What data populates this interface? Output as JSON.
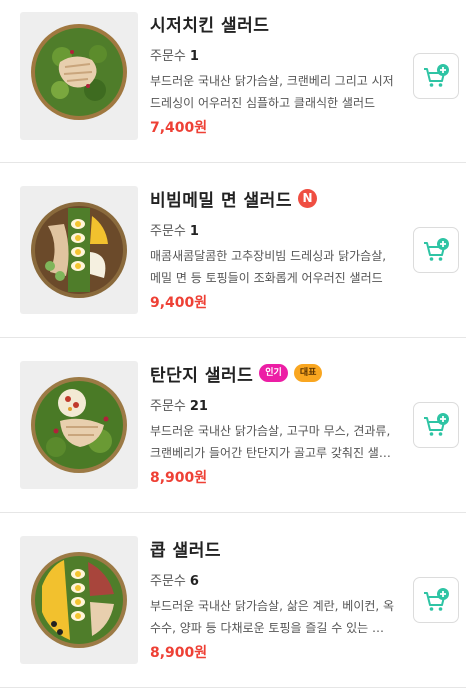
{
  "items": [
    {
      "name": "시저치킨 샐러드",
      "orders_label": "주문수",
      "orders": "1",
      "description": "부드러운 국내산 닭가슴살, 크랜베리 그리고 시저 드레싱이 어우러진 심플하고 클래식한 샐러드",
      "price": "7,400원"
    },
    {
      "name": "비빔메밀 면 샐러드",
      "new_badge": "N",
      "orders_label": "주문수",
      "orders": "1",
      "description": "매콤새콤달콤한 고추장비빔 드레싱과 닭가슴살, 메밀 면 등 토핑들이 조화롭게 어우러진 샐러드",
      "price": "9,400원"
    },
    {
      "name": "탄단지 샐러드",
      "tags": [
        "인기",
        "대표"
      ],
      "orders_label": "주문수",
      "orders": "21",
      "description": "부드러운 국내산 닭가슴살, 고구마 무스, 견과류, 크랜베리가 들어간 탄단지가 골고루 갖춰진 샐러드",
      "price": "8,900원"
    },
    {
      "name": "콥 샐러드",
      "orders_label": "주문수",
      "orders": "6",
      "description": "부드러운 국내산 닭가슴살, 삶은 계란, 베이컨, 옥수수, 양파 등 다채로운 토핑을 즐길 수 있는 샐러드",
      "price": "8,900원"
    }
  ],
  "colors": {
    "price": "#ee4035",
    "cart_icon": "#2ec4a4",
    "badge_new": "#ef4e42",
    "tag_popular": "#ec1ea5",
    "tag_representative": "#f9a620"
  },
  "icons": {
    "cart": "add-to-cart-icon",
    "new": "new-badge-icon"
  }
}
